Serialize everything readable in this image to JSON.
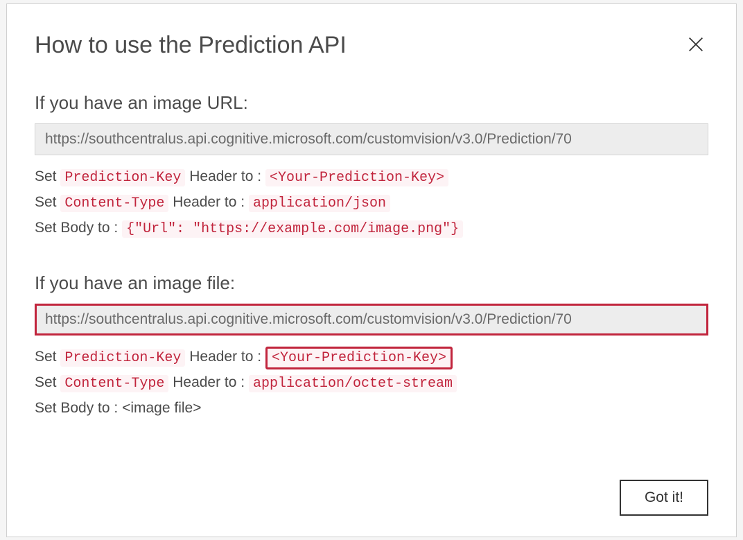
{
  "dialog": {
    "title": "How to use the Prediction API",
    "section1": {
      "heading": "If you have an image URL:",
      "url": "https://southcentralus.api.cognitive.microsoft.com/customvision/v3.0/Prediction/70",
      "line1_prefix": "Set ",
      "line1_code1": "Prediction-Key",
      "line1_mid": " Header to : ",
      "line1_code2": "<Your-Prediction-Key>",
      "line2_prefix": "Set ",
      "line2_code1": "Content-Type",
      "line2_mid": " Header to : ",
      "line2_code2": "application/json",
      "line3_prefix": "Set Body to : ",
      "line3_code1": "{\"Url\": \"https://example.com/image.png\"}"
    },
    "section2": {
      "heading": "If you have an image file:",
      "url": "https://southcentralus.api.cognitive.microsoft.com/customvision/v3.0/Prediction/70",
      "line1_prefix": "Set ",
      "line1_code1": "Prediction-Key",
      "line1_mid": " Header to : ",
      "line1_code2": "<Your-Prediction-Key>",
      "line2_prefix": "Set ",
      "line2_code1": "Content-Type",
      "line2_mid": " Header to : ",
      "line2_code2": "application/octet-stream",
      "line3": "Set Body to : <image file>"
    },
    "footer": {
      "button": "Got it!"
    }
  }
}
